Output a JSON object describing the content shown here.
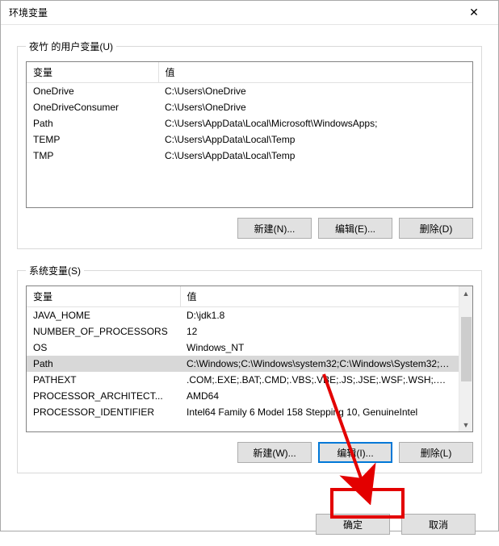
{
  "titlebar": {
    "title": "环境变量",
    "close_icon": "✕"
  },
  "user_section": {
    "legend": "夜竹 的用户变量(U)",
    "columns": {
      "variable": "变量",
      "value": "值"
    },
    "rows": [
      {
        "name": "OneDrive",
        "value": "C:\\Users\\OneDrive"
      },
      {
        "name": "OneDriveConsumer",
        "value": "C:\\Users\\OneDrive"
      },
      {
        "name": "Path",
        "value": "C:\\Users\\AppData\\Local\\Microsoft\\WindowsApps;"
      },
      {
        "name": "TEMP",
        "value": "C:\\Users\\AppData\\Local\\Temp"
      },
      {
        "name": "TMP",
        "value": "C:\\Users\\AppData\\Local\\Temp"
      }
    ],
    "buttons": {
      "new": "新建(N)...",
      "edit": "编辑(E)...",
      "delete": "删除(D)"
    }
  },
  "system_section": {
    "legend": "系统变量(S)",
    "columns": {
      "variable": "变量",
      "value": "值"
    },
    "rows": [
      {
        "name": "JAVA_HOME",
        "value": "D:\\jdk1.8"
      },
      {
        "name": "NUMBER_OF_PROCESSORS",
        "value": "12"
      },
      {
        "name": "OS",
        "value": "Windows_NT"
      },
      {
        "name": "Path",
        "value": "C:\\Windows;C:\\Windows\\system32;C:\\Windows\\System32;C:\\...",
        "selected": true
      },
      {
        "name": "PATHEXT",
        "value": ".COM;.EXE;.BAT;.CMD;.VBS;.VBE;.JS;.JSE;.WSF;.WSH;.MSC"
      },
      {
        "name": "PROCESSOR_ARCHITECT...",
        "value": "AMD64"
      },
      {
        "name": "PROCESSOR_IDENTIFIER",
        "value": "Intel64 Family 6 Model 158 Stepping 10, GenuineIntel"
      }
    ],
    "buttons": {
      "new": "新建(W)...",
      "edit": "编辑(I)...",
      "delete": "删除(L)"
    }
  },
  "footer": {
    "ok": "确定",
    "cancel": "取消"
  }
}
